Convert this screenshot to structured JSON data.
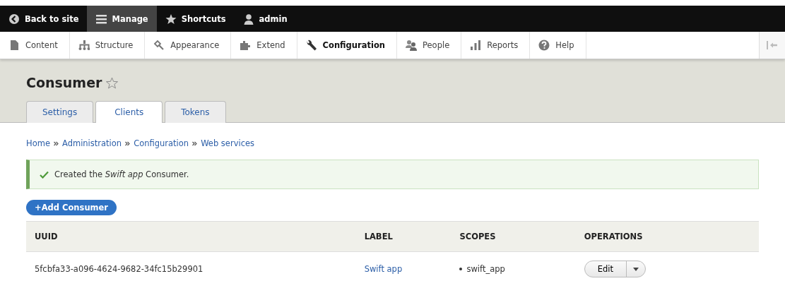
{
  "toolbar": {
    "items": [
      {
        "label": "Back to site",
        "selected": false
      },
      {
        "label": "Manage",
        "selected": true
      },
      {
        "label": "Shortcuts",
        "selected": false
      },
      {
        "label": "admin",
        "selected": false
      }
    ]
  },
  "menu": {
    "items": [
      {
        "label": "Content",
        "selected": false
      },
      {
        "label": "Structure",
        "selected": false
      },
      {
        "label": "Appearance",
        "selected": false
      },
      {
        "label": "Extend",
        "selected": false
      },
      {
        "label": "Configuration",
        "selected": true
      },
      {
        "label": "People",
        "selected": false
      },
      {
        "label": "Reports",
        "selected": false
      },
      {
        "label": "Help",
        "selected": false
      }
    ]
  },
  "page": {
    "title": "Consumer"
  },
  "tabs": [
    {
      "label": "Settings",
      "selected": false
    },
    {
      "label": "Clients",
      "selected": true
    },
    {
      "label": "Tokens",
      "selected": false
    }
  ],
  "breadcrumb": [
    "Home",
    "Administration",
    "Configuration",
    "Web services"
  ],
  "message": {
    "text": "Created the *Swift app* Consumer."
  },
  "add_button": "+Add Consumer",
  "table": {
    "columns": [
      "UUID",
      "LABEL",
      "SCOPES",
      "OPERATIONS"
    ],
    "rows": [
      {
        "uuid": "5fcbfa33-a096-4624-9682-34fc15b29901",
        "label": "Swift app",
        "scopes": [
          "swift_app"
        ],
        "operation": "Edit"
      }
    ]
  }
}
